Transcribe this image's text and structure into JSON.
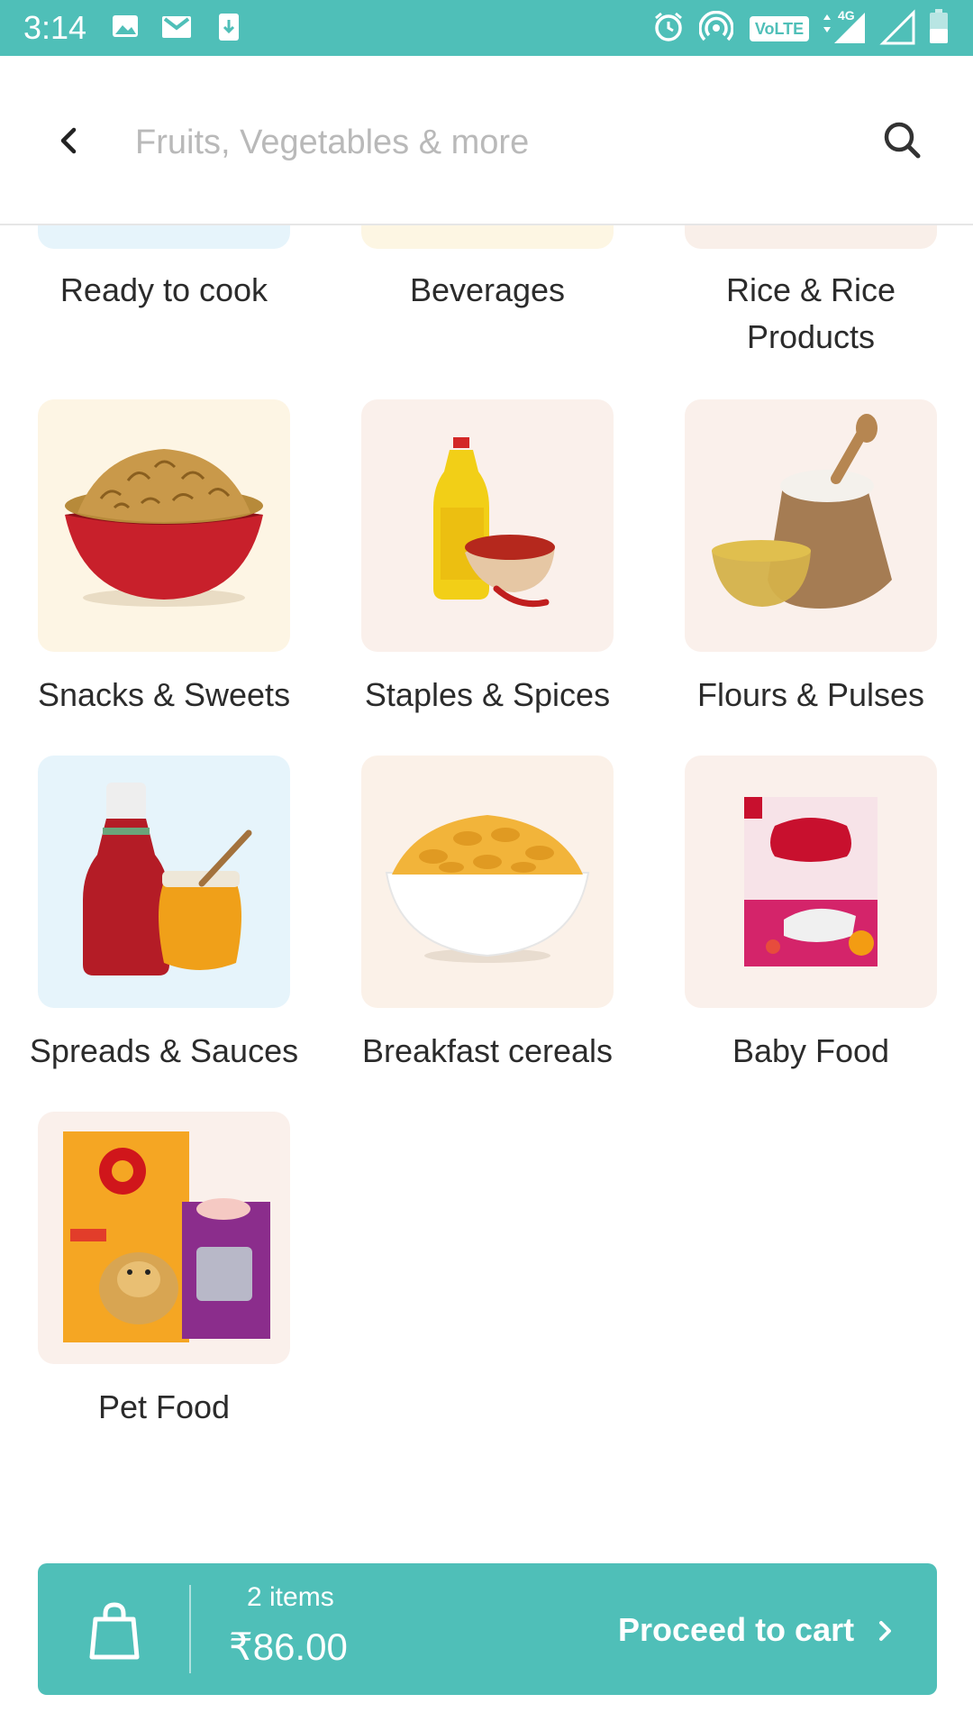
{
  "status_bar": {
    "time": "3:14",
    "network_label": "VoLTE",
    "network_type": "4G",
    "icons": [
      "image-icon",
      "gmail-icon",
      "download-icon",
      "alarm-icon",
      "hotspot-icon",
      "signal-icon",
      "battery-icon"
    ]
  },
  "header": {
    "search_placeholder": "Fruits, Vegetables & more",
    "back_icon": "chevron-left-icon",
    "search_icon": "search-icon"
  },
  "categories_partial": [
    {
      "label": "Ready to cook",
      "bg": "#e6f4fb"
    },
    {
      "label": "Beverages",
      "bg": "#fdf6e3"
    },
    {
      "label": "Rice & Rice Products",
      "bg": "#f9efe9"
    }
  ],
  "categories": [
    {
      "label": "Snacks & Sweets",
      "bg": "#fdf5e4",
      "icon": "snacks-icon"
    },
    {
      "label": "Staples & Spices",
      "bg": "#faf0eb",
      "icon": "oil-spices-icon"
    },
    {
      "label": "Flours & Pulses",
      "bg": "#faf0eb",
      "icon": "flour-sack-icon"
    },
    {
      "label": "Spreads & Sauces",
      "bg": "#e6f4fb",
      "icon": "ketchup-honey-icon"
    },
    {
      "label": "Breakfast cereals",
      "bg": "#fbf1e8",
      "icon": "cereal-bowl-icon"
    },
    {
      "label": "Baby Food",
      "bg": "#faf0eb",
      "icon": "baby-food-box-icon"
    },
    {
      "label": "Pet Food",
      "bg": "#faf0eb",
      "icon": "pet-food-icon"
    }
  ],
  "cart": {
    "items_text": "2 items",
    "total": "₹86.00",
    "proceed_label": "Proceed to cart",
    "color": "#4fbfb8"
  }
}
